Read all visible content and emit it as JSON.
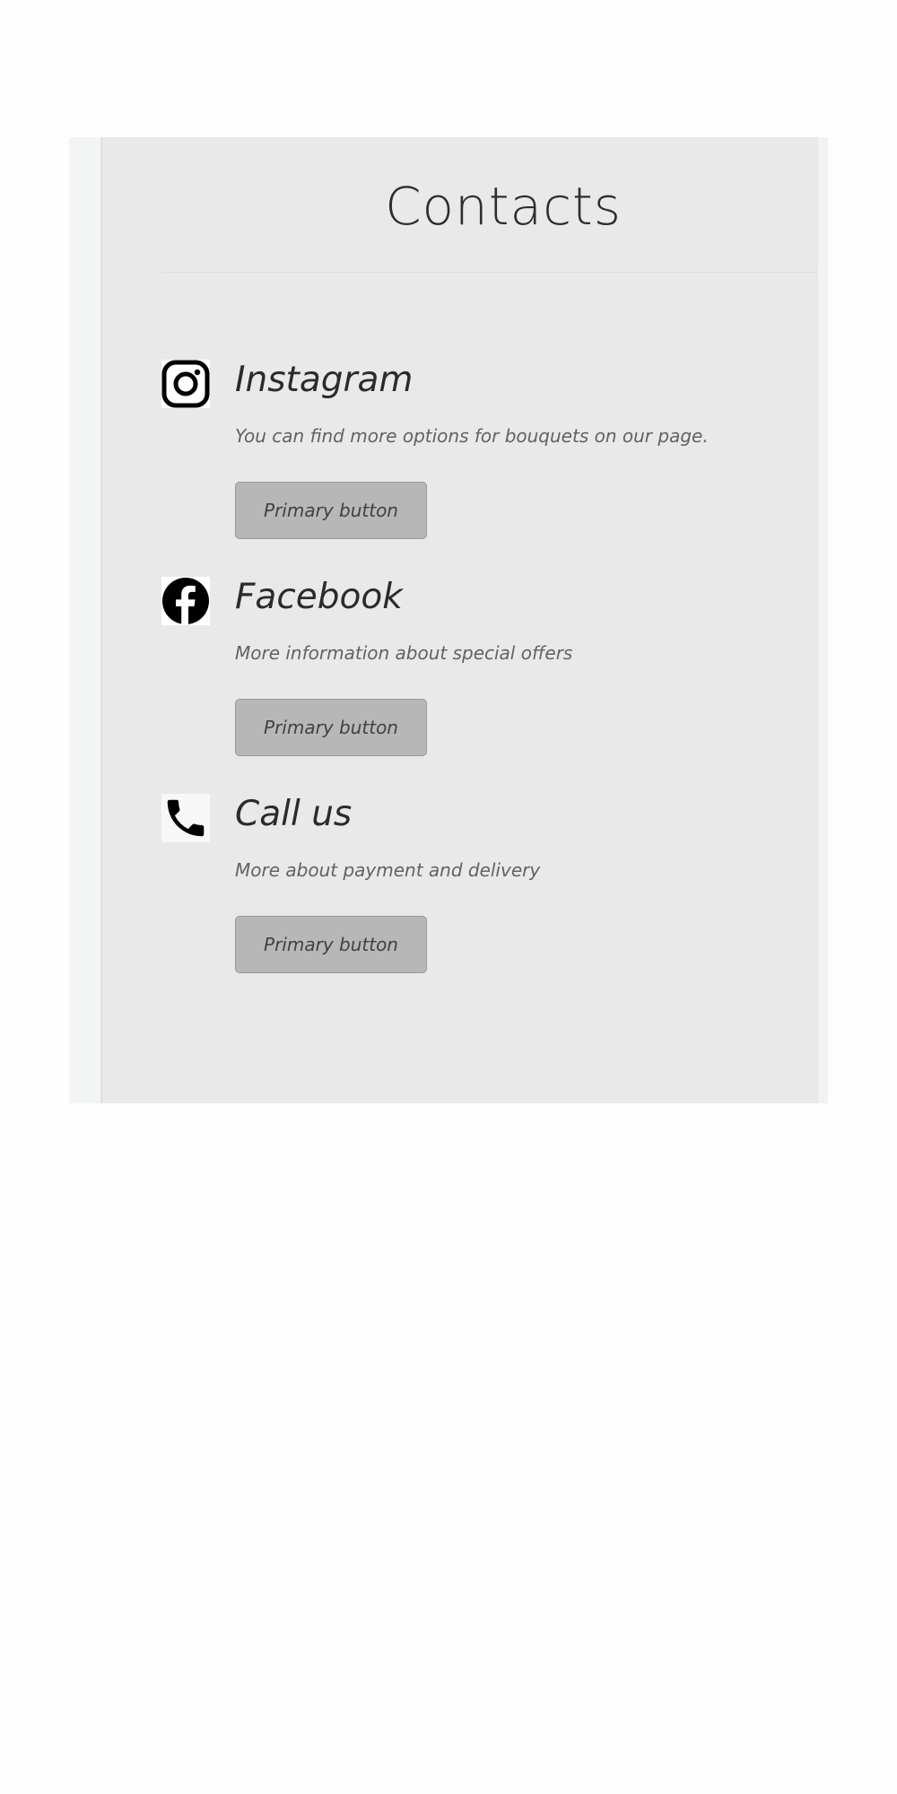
{
  "page": {
    "title": "Contacts"
  },
  "contacts": [
    {
      "icon": "instagram-icon",
      "title": "Instagram",
      "description": "You can find more options for bouquets on our page.",
      "button_label": "Primary button"
    },
    {
      "icon": "facebook-icon",
      "title": "Facebook",
      "description": "More information about special offers",
      "button_label": "Primary button"
    },
    {
      "icon": "phone-icon",
      "title": "Call us",
      "description": "More about payment and delivery",
      "button_label": "Primary button"
    }
  ],
  "colors": {
    "panel_background": "#e9e9e9",
    "button_background": "#b7b7b7",
    "text_primary": "#2b2b2b",
    "text_secondary": "#626262"
  }
}
